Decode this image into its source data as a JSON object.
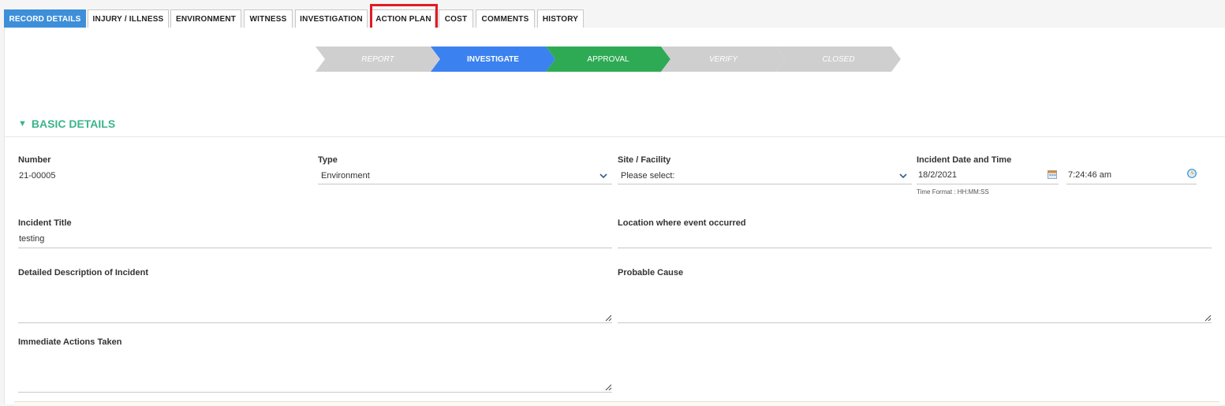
{
  "tabs": [
    {
      "label": "RECORD DETAILS",
      "active": true
    },
    {
      "label": "INJURY / ILLNESS",
      "active": false
    },
    {
      "label": "ENVIRONMENT",
      "active": false
    },
    {
      "label": "WITNESS",
      "active": false
    },
    {
      "label": "INVESTIGATION",
      "active": false
    },
    {
      "label": "ACTION PLAN",
      "active": false,
      "highlighted": true
    },
    {
      "label": "COST",
      "active": false
    },
    {
      "label": "COMMENTS",
      "active": false
    },
    {
      "label": "HISTORY",
      "active": false
    }
  ],
  "workflow": {
    "steps": [
      {
        "label": "REPORT",
        "state": "done",
        "color": "#cfcfcf"
      },
      {
        "label": "INVESTIGATE",
        "state": "current",
        "color": "#3b82f0"
      },
      {
        "label": "APPROVAL",
        "state": "current",
        "color": "#2eaa55"
      },
      {
        "label": "VERIFY",
        "state": "pending",
        "color": "#cfcfcf"
      },
      {
        "label": "CLOSED",
        "state": "pending",
        "color": "#cfcfcf"
      }
    ]
  },
  "section": {
    "title": "BASIC DETAILS",
    "toggle_glyph": "▼",
    "accent_color": "#3cb48c"
  },
  "fields": {
    "number": {
      "label": "Number",
      "value": "21-00005"
    },
    "type": {
      "label": "Type",
      "value": "Environment"
    },
    "site": {
      "label": "Site / Facility",
      "value": "Please select:"
    },
    "incident_datetime": {
      "label": "Incident Date and Time",
      "date": "18/2/2021",
      "time": "7:24:46 am",
      "time_format": "Time Format : HH:MM:SS"
    },
    "incident_title": {
      "label": "Incident Title",
      "value": "testing"
    },
    "location": {
      "label": "Location where event occurred",
      "value": ""
    },
    "description": {
      "label": "Detailed Description of Incident",
      "value": ""
    },
    "probable_cause": {
      "label": "Probable Cause",
      "value": ""
    },
    "immediate_actions": {
      "label": "Immediate Actions Taken",
      "value": ""
    }
  }
}
